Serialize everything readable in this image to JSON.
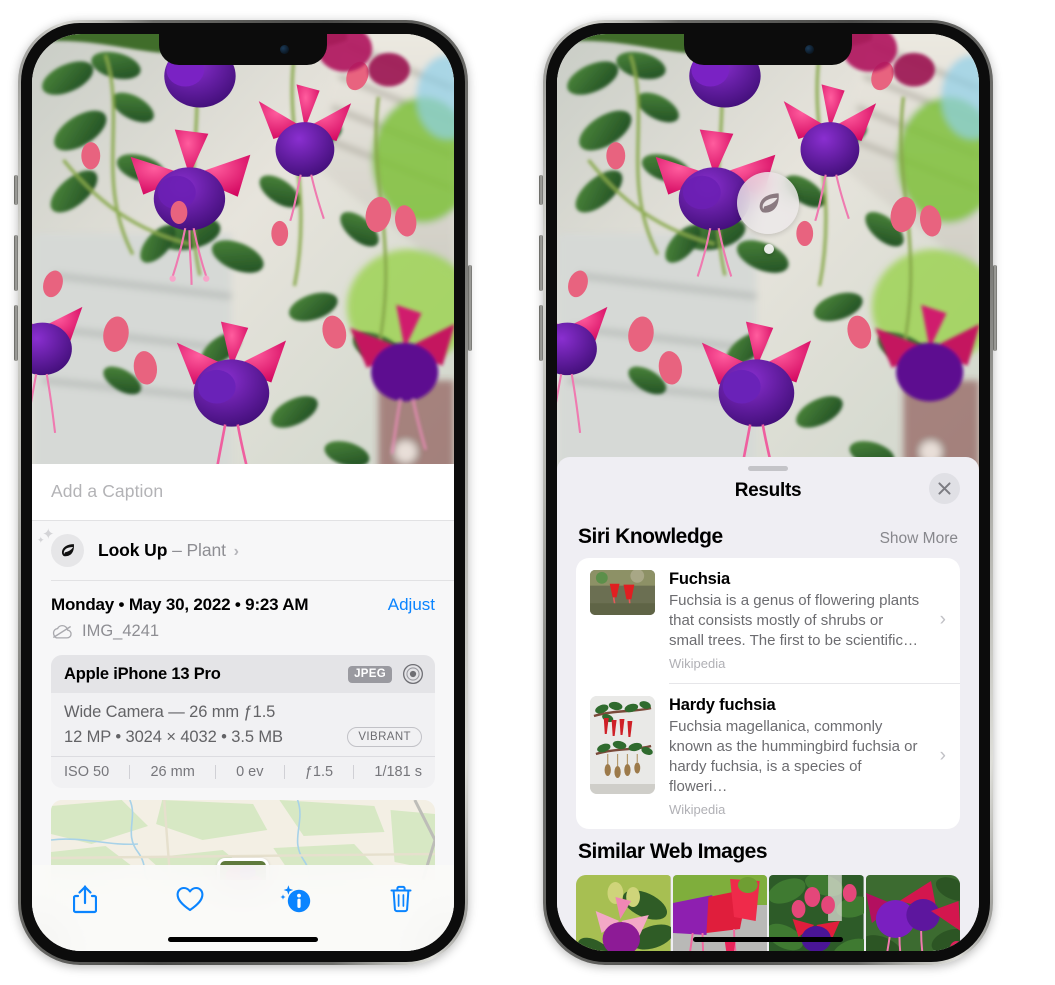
{
  "left_phone": {
    "photo": {
      "alt_name": "fuchsia-flowers-photo"
    },
    "caption_field": {
      "placeholder": "Add a Caption",
      "value": ""
    },
    "lookup_row": {
      "label": "Look Up",
      "dash": "–",
      "subject": "Plant",
      "chevron": "›",
      "icon": "leaf-icon"
    },
    "info": {
      "date": "Monday • May 30, 2022 • 9:23 AM",
      "adjust_label": "Adjust",
      "filename": "IMG_4241",
      "cloud_icon": "icloud-slash-icon"
    },
    "camera_card": {
      "device": "Apple iPhone 13 Pro",
      "format_badge": "JPEG",
      "raw_icon": "aperture-icon",
      "lens_line": "Wide Camera — 26 mm ƒ1.5",
      "spec_line": "12 MP • 3024 × 4032 • 3.5 MB",
      "style_badge": "VIBRANT",
      "exif": [
        "ISO 50",
        "26 mm",
        "0 ev",
        "ƒ1.5",
        "1/181 s"
      ]
    },
    "toolbar": [
      {
        "name": "share-button",
        "icon": "share-icon"
      },
      {
        "name": "favorite-button",
        "icon": "heart-icon"
      },
      {
        "name": "info-button",
        "icon": "info-sparkle-icon"
      },
      {
        "name": "delete-button",
        "icon": "trash-icon"
      }
    ],
    "accent_color": "#0a84ff"
  },
  "right_phone": {
    "photo_badge": {
      "icon": "leaf-icon",
      "name": "visual-lookup-badge"
    },
    "sheet": {
      "title": "Results",
      "close_label": "✕",
      "sections": [
        {
          "title": "Siri Knowledge",
          "action": "Show More",
          "items": [
            {
              "title": "Fuchsia",
              "description": "Fuchsia is a genus of flowering plants that consists mostly of shrubs or small trees. The first to be scientific…",
              "source": "Wikipedia",
              "chevron": "›"
            },
            {
              "title": "Hardy fuchsia",
              "description": "Fuchsia magellanica, commonly known as the hummingbird fuchsia or hardy fuchsia, is a species of floweri…",
              "source": "Wikipedia",
              "chevron": "›"
            }
          ]
        },
        {
          "title": "Similar Web Images",
          "action": "",
          "tiles": [
            "web-image-1",
            "web-image-2",
            "web-image-3",
            "web-image-4"
          ]
        }
      ]
    }
  }
}
